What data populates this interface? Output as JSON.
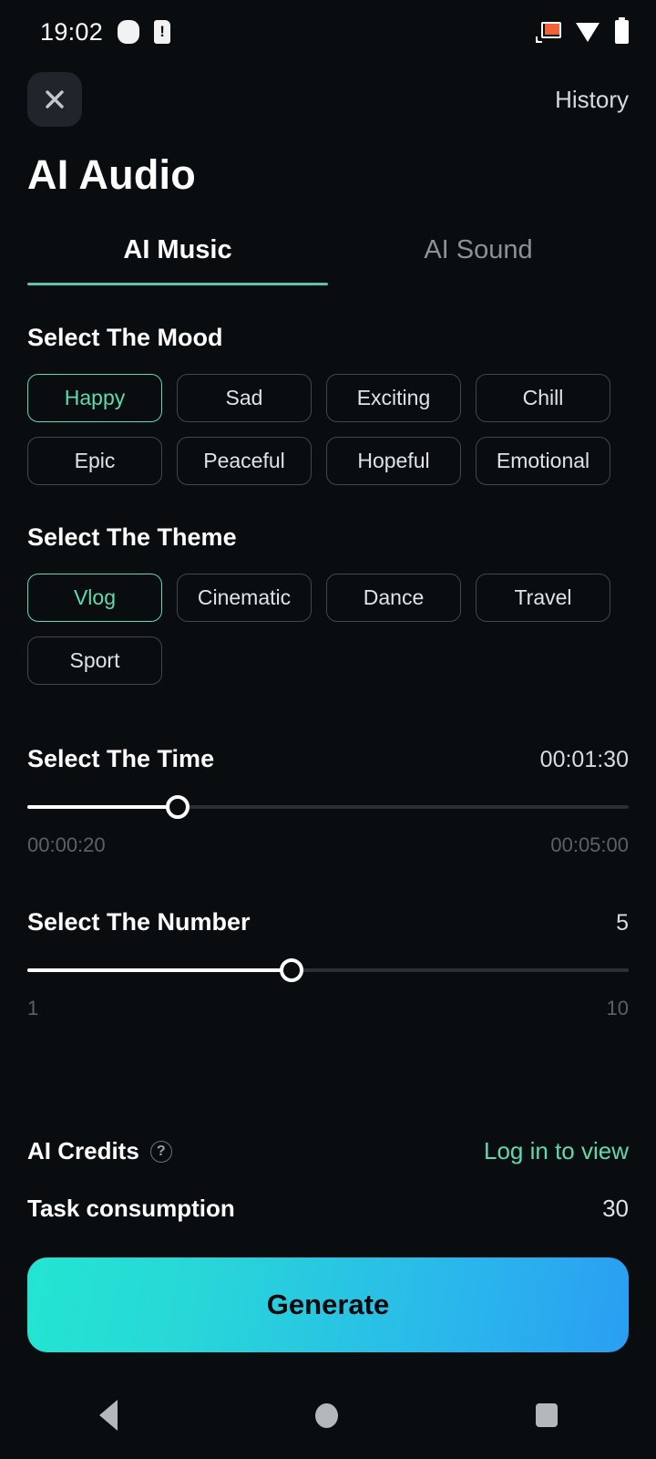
{
  "status_bar": {
    "time": "19:02",
    "left_icons": [
      "dot-icon",
      "sim-alert-icon"
    ],
    "right_icons": [
      "cast-icon",
      "wifi-icon",
      "battery-icon"
    ]
  },
  "top_bar": {
    "close_label": "close-icon",
    "history_label": "History"
  },
  "page_title": "AI Audio",
  "tabs": [
    {
      "label": "AI Music",
      "active": true
    },
    {
      "label": "AI Sound",
      "active": false
    }
  ],
  "mood": {
    "title": "Select The Mood",
    "options": [
      {
        "label": "Happy",
        "selected": true
      },
      {
        "label": "Sad",
        "selected": false
      },
      {
        "label": "Exciting",
        "selected": false
      },
      {
        "label": "Chill",
        "selected": false
      },
      {
        "label": "Epic",
        "selected": false
      },
      {
        "label": "Peaceful",
        "selected": false
      },
      {
        "label": "Hopeful",
        "selected": false
      },
      {
        "label": "Emotional",
        "selected": false
      }
    ]
  },
  "theme": {
    "title": "Select The Theme",
    "options": [
      {
        "label": "Vlog",
        "selected": true
      },
      {
        "label": "Cinematic",
        "selected": false
      },
      {
        "label": "Dance",
        "selected": false
      },
      {
        "label": "Travel",
        "selected": false
      },
      {
        "label": "Sport",
        "selected": false
      }
    ]
  },
  "time_slider": {
    "title": "Select The Time",
    "value": "00:01:30",
    "min_label": "00:00:20",
    "max_label": "00:05:00",
    "percent": 25
  },
  "number_slider": {
    "title": "Select The Number",
    "value": "5",
    "min_label": "1",
    "max_label": "10",
    "percent": 44
  },
  "credits": {
    "label": "AI Credits",
    "help_glyph": "?",
    "action": "Log in to view"
  },
  "consumption": {
    "label": "Task consumption",
    "value": "30"
  },
  "generate": {
    "label": "Generate"
  },
  "nav_bar": {
    "back": "back-icon",
    "home": "home-icon",
    "recent": "recent-apps-icon"
  },
  "colors": {
    "background": "#0a0d0f",
    "accent_green": "#5fd9ae",
    "tab_underline": "#59c4a8",
    "gradient_start": "#23e5d1",
    "gradient_end": "#2a9ef2",
    "cast_orange": "#f0623a"
  }
}
